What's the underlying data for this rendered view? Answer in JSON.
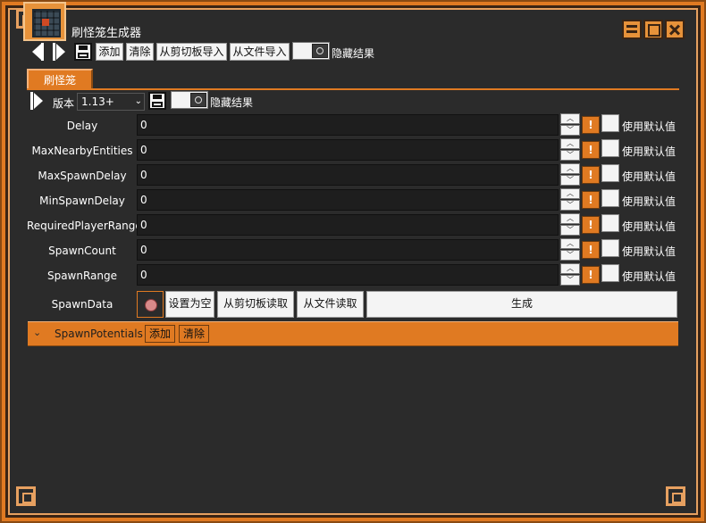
{
  "window": {
    "title": "刷怪笼生成器",
    "icon": "spawner-cage-icon"
  },
  "toolbar": {
    "add_label": "添加",
    "clear_label": "清除",
    "import_clipboard_label": "从剪切板导入",
    "import_file_label": "从文件导入",
    "hide_result_label": "隐藏结果"
  },
  "tabs": [
    {
      "label": "刷怪笼",
      "active": true
    }
  ],
  "version_row": {
    "label": "版本",
    "selected": "1.13+",
    "hide_result_label": "隐藏结果"
  },
  "fields": [
    {
      "label": "Delay",
      "value": "0",
      "default_label": "使用默认值"
    },
    {
      "label": "MaxNearbyEntities",
      "value": "0",
      "default_label": "使用默认值"
    },
    {
      "label": "MaxSpawnDelay",
      "value": "0",
      "default_label": "使用默认值"
    },
    {
      "label": "MinSpawnDelay",
      "value": "0",
      "default_label": "使用默认值"
    },
    {
      "label": "RequiredPlayerRange",
      "value": "0",
      "default_label": "使用默认值"
    },
    {
      "label": "SpawnCount",
      "value": "0",
      "default_label": "使用默认值"
    },
    {
      "label": "SpawnRange",
      "value": "0",
      "default_label": "使用默认值"
    }
  ],
  "spawn_data": {
    "label": "SpawnData",
    "set_empty_label": "设置为空",
    "read_clipboard_label": "从剪切板读取",
    "read_file_label": "从文件读取",
    "generate_label": "生成"
  },
  "spawn_potentials": {
    "label": "SpawnPotentials",
    "add_label": "添加",
    "clear_label": "清除"
  },
  "colors": {
    "accent": "#e07a22",
    "background": "#2b2b2b",
    "input_bg": "#1e1e1e"
  }
}
